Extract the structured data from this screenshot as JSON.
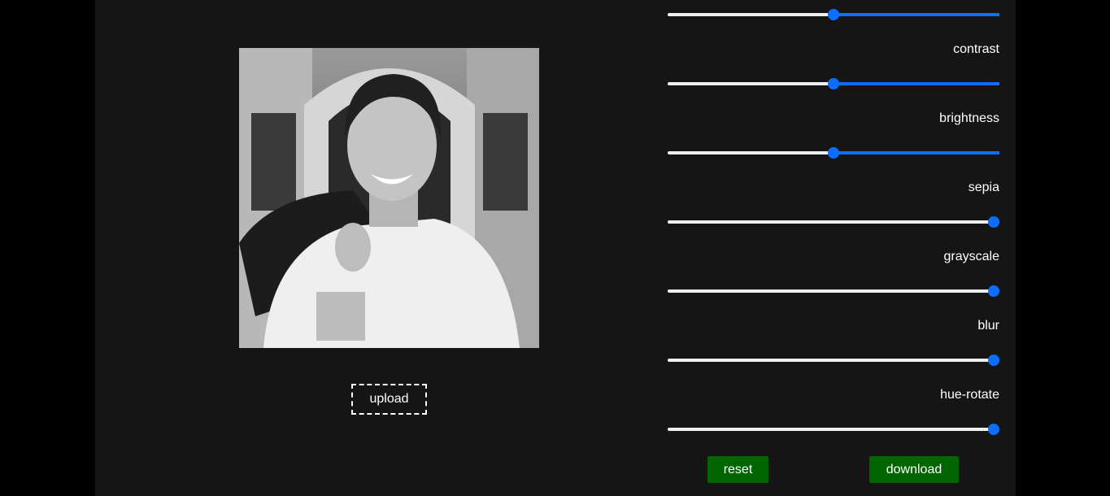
{
  "image": {
    "alt": "grayscale portrait photo",
    "upload_label": "upload"
  },
  "controls": [
    {
      "id": "saturate",
      "label": "",
      "value": 0.5
    },
    {
      "id": "contrast",
      "label": "contrast",
      "value": 0.5
    },
    {
      "id": "brightness",
      "label": "brightness",
      "value": 0.5
    },
    {
      "id": "sepia",
      "label": "sepia",
      "value": 1.0
    },
    {
      "id": "grayscale",
      "label": "grayscale",
      "value": 1.0
    },
    {
      "id": "blur",
      "label": "blur",
      "value": 1.0
    },
    {
      "id": "hue-rotate",
      "label": "hue-rotate",
      "value": 1.0
    }
  ],
  "actions": {
    "reset_label": "reset",
    "download_label": "download"
  },
  "colors": {
    "page_background": "#000000",
    "panel_background": "#151515",
    "slider_accent": "#0d6efd",
    "slider_track": "#efefef",
    "button_background": "#006400",
    "text": "#ffffff"
  }
}
